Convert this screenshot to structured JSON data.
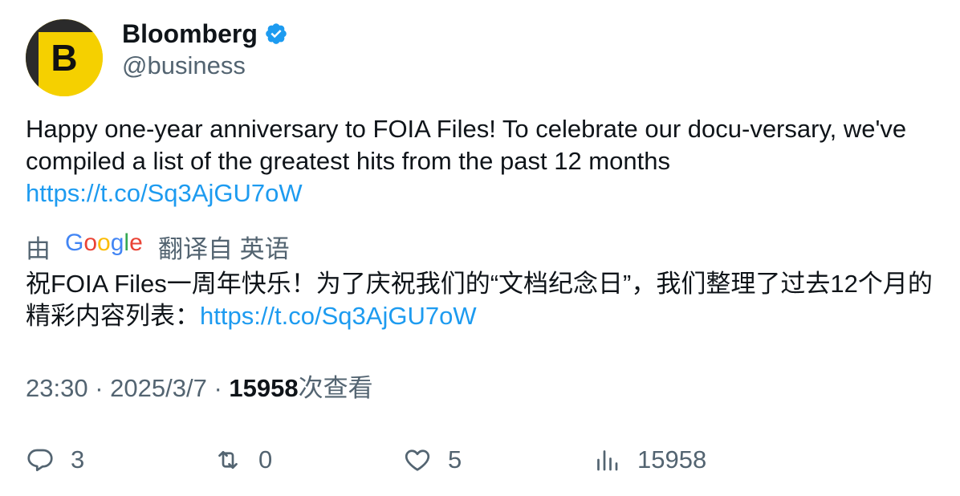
{
  "author": {
    "display_name": "Bloomberg",
    "handle": "@business",
    "avatar_letter": "B",
    "verified": true,
    "verified_color": "#1d9bf0",
    "avatar_color": "#f5d000"
  },
  "tweet": {
    "text": "Happy one-year anniversary to FOIA Files! To celebrate our docu-versary, we've compiled a list of the greatest hits from the past 12 months",
    "link": "https://t.co/Sq3AjGU7oW"
  },
  "translation": {
    "prefix": "由",
    "provider_icon": "google-logo",
    "suffix": "翻译自 英语",
    "text": "祝FOIA Files一周年快乐！为了庆祝我们的“文档纪念日”，我们整理了过去12个月的精彩内容列表：",
    "link": "https://t.co/Sq3AjGU7oW"
  },
  "meta": {
    "time": "23:30",
    "separator": "·",
    "date": "2025/3/7",
    "views": "15958",
    "views_label": "次查看"
  },
  "actions": {
    "replies": "3",
    "retweets": "0",
    "likes": "5",
    "views": "15958"
  },
  "colors": {
    "text": "#0f1419",
    "secondary": "#536471",
    "link": "#1d9bf0"
  }
}
